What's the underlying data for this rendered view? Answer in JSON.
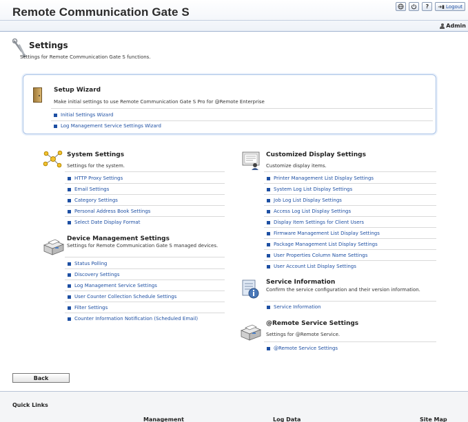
{
  "header": {
    "app_title": "Remote Communication Gate S",
    "icons": [
      "globe-icon",
      "power-icon",
      "help-icon"
    ],
    "logout_label": "Logout",
    "user_label": "Admin"
  },
  "page": {
    "title": "Settings",
    "description": "Settings for Remote Communication Gate S functions."
  },
  "setup_wizard": {
    "title": "Setup Wizard",
    "description": "Make initial settings to use Remote Communication Gate S Pro for @Remote Enterprise",
    "links": [
      "Initial Settings Wizard",
      "Log Management Service Settings Wizard"
    ]
  },
  "system_settings": {
    "title": "System Settings",
    "description": "Settings for the system.",
    "links": [
      "HTTP Proxy Settings",
      "Email Settings",
      "Category Settings",
      "Personal Address Book Settings",
      "Select Date Display Format"
    ]
  },
  "device_management": {
    "title": "Device Management Settings",
    "description": "Settings for Remote Communication Gate S managed devices.",
    "links": [
      "Status Polling",
      "Discovery Settings",
      "Log Management Service Settings",
      "User Counter Collection Schedule Settings",
      "Filter Settings",
      "Counter Information Notification (Scheduled Email)"
    ]
  },
  "customized_display": {
    "title": "Customized Display Settings",
    "description": "Customize display items.",
    "links": [
      "Printer Management List Display Settings",
      "System Log List Display Settings",
      "Job Log List Display Settings",
      "Access Log List Display Settings",
      "Display Item Settings for Client Users",
      "Firmware Management List Display Settings",
      "Package Management List Display Settings",
      "User Properties Column Name Settings",
      "User Account List Display Settings"
    ]
  },
  "service_information": {
    "title": "Service Information",
    "description": "Confirm the service configuration and their version information.",
    "links": [
      "Service Information"
    ]
  },
  "remote_service": {
    "title": "@Remote Service Settings",
    "description": "Settings for @Remote Service.",
    "links": [
      "@Remote Service Settings"
    ]
  },
  "back_label": "Back",
  "quick_links": {
    "title": "Quick Links",
    "columns": [
      "Management",
      "Log Data",
      "Site Map"
    ]
  }
}
